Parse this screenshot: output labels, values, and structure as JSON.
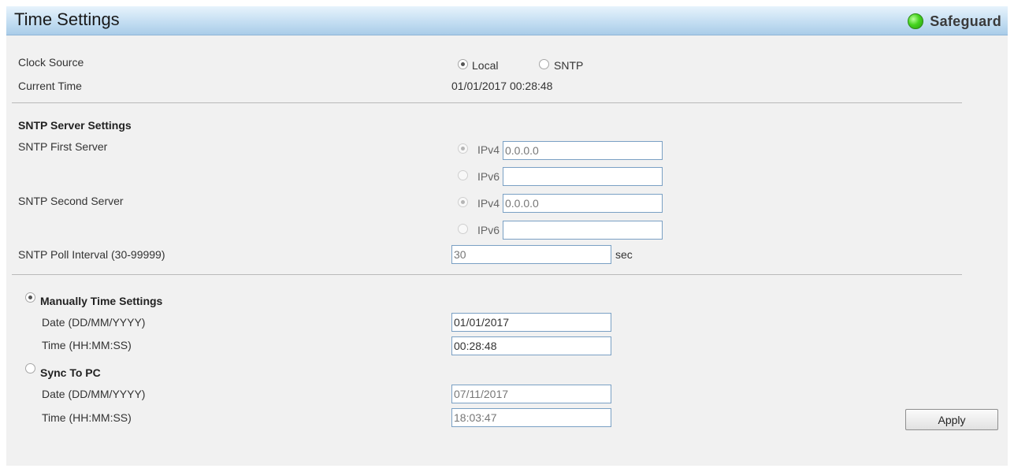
{
  "header": {
    "title": "Time Settings",
    "status_label": "Safeguard",
    "status_color": "#45d41e"
  },
  "time_source": {
    "clock_source_label": "Clock Source",
    "options": [
      {
        "label": "Local",
        "selected": true
      },
      {
        "label": "SNTP",
        "selected": false
      }
    ],
    "current_time_label": "Current Time",
    "current_time_value": "01/01/2017 00:28:48"
  },
  "sntp": {
    "section_title": "SNTP Server Settings",
    "first_server_label": "SNTP First Server",
    "second_server_label": "SNTP Second Server",
    "ipv4_label": "IPv4",
    "ipv6_label": "IPv6",
    "first_ipv4_value": "0.0.0.0",
    "first_ipv6_value": "",
    "second_ipv4_value": "0.0.0.0",
    "second_ipv6_value": "",
    "poll_interval_label": "SNTP Poll Interval (30-99999)",
    "poll_interval_value": "30",
    "poll_interval_unit": "sec"
  },
  "manual": {
    "title": "Manually Time Settings",
    "selected": true,
    "date_label": "Date (DD/MM/YYYY)",
    "date_value": "01/01/2017",
    "time_label": "Time (HH:MM:SS)",
    "time_value": "00:28:48"
  },
  "sync_pc": {
    "title": "Sync To PC",
    "selected": false,
    "date_label": "Date (DD/MM/YYYY)",
    "date_value": "07/11/2017",
    "time_label": "Time (HH:MM:SS)",
    "time_value": "18:03:47"
  },
  "actions": {
    "apply_label": "Apply"
  }
}
